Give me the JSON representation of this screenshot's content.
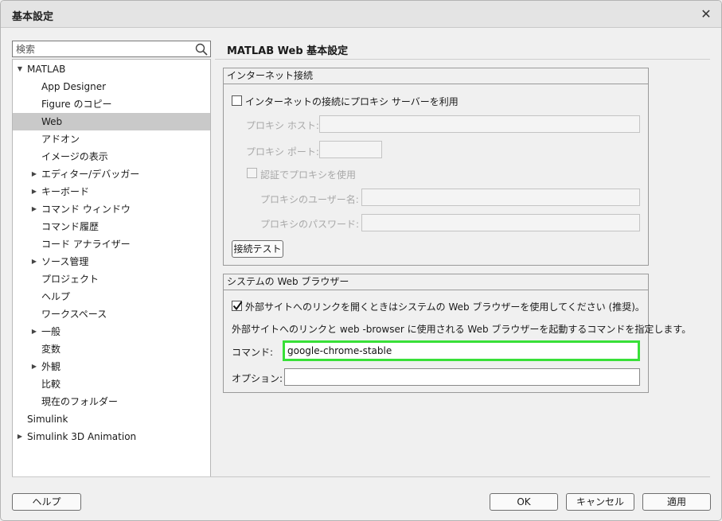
{
  "window": {
    "title": "基本設定",
    "close_glyph": "✕"
  },
  "search": {
    "placeholder": "検索",
    "icon": "search-icon"
  },
  "tree": {
    "items": [
      {
        "label": "MATLAB",
        "level": 0,
        "arrow": "down"
      },
      {
        "label": "App Designer",
        "level": 1,
        "arrow": ""
      },
      {
        "label": "Figure のコピー",
        "level": 1,
        "arrow": ""
      },
      {
        "label": "Web",
        "level": 1,
        "arrow": "",
        "selected": true
      },
      {
        "label": "アドオン",
        "level": 1,
        "arrow": ""
      },
      {
        "label": "イメージの表示",
        "level": 1,
        "arrow": ""
      },
      {
        "label": "エディター/デバッガー",
        "level": 1,
        "arrow": "right"
      },
      {
        "label": "キーボード",
        "level": 1,
        "arrow": "right"
      },
      {
        "label": "コマンド ウィンドウ",
        "level": 1,
        "arrow": "right"
      },
      {
        "label": "コマンド履歴",
        "level": 1,
        "arrow": ""
      },
      {
        "label": "コード アナライザー",
        "level": 1,
        "arrow": ""
      },
      {
        "label": "ソース管理",
        "level": 1,
        "arrow": "right"
      },
      {
        "label": "プロジェクト",
        "level": 1,
        "arrow": ""
      },
      {
        "label": "ヘルプ",
        "level": 1,
        "arrow": ""
      },
      {
        "label": "ワークスペース",
        "level": 1,
        "arrow": ""
      },
      {
        "label": "一般",
        "level": 1,
        "arrow": "right"
      },
      {
        "label": "変数",
        "level": 1,
        "arrow": ""
      },
      {
        "label": "外観",
        "level": 1,
        "arrow": "right"
      },
      {
        "label": "比較",
        "level": 1,
        "arrow": ""
      },
      {
        "label": "現在のフォルダー",
        "level": 1,
        "arrow": ""
      },
      {
        "label": "Simulink",
        "level": 0,
        "arrow": ""
      },
      {
        "label": "Simulink 3D Animation",
        "level": 0,
        "arrow": "right"
      }
    ]
  },
  "panel": {
    "title": "MATLAB Web 基本設定",
    "internet": {
      "header": "インターネット接続",
      "use_proxy_label": "インターネットの接続にプロキシ サーバーを利用",
      "use_proxy_checked": false,
      "proxy_host_label": "プロキシ ホスト:",
      "proxy_host_value": "",
      "proxy_port_label": "プロキシ ポート:",
      "proxy_port_value": "",
      "auth_label": "認証でプロキシを使用",
      "auth_checked": false,
      "proxy_user_label": "プロキシのユーザー名:",
      "proxy_user_value": "",
      "proxy_pass_label": "プロキシのパスワード:",
      "proxy_pass_value": "",
      "test_button": "接続テスト"
    },
    "browser": {
      "header": "システムの Web ブラウザー",
      "use_system_label": "外部サイトへのリンクを開くときはシステムの Web ブラウザーを使用してください (推奨)。",
      "use_system_checked": true,
      "description": "外部サイトへのリンクと web -browser に使用される Web ブラウザーを起動するコマンドを指定します。",
      "command_label": "コマンド:",
      "command_value": "google-chrome-stable",
      "options_label": "オプション:",
      "options_value": ""
    }
  },
  "footer": {
    "help_button": "ヘルプ",
    "ok_button": "OK",
    "cancel_button": "キャンセル",
    "apply_button": "適用"
  },
  "colors": {
    "focus_border": "#38e038",
    "selected_row": "#c9c9c9"
  }
}
